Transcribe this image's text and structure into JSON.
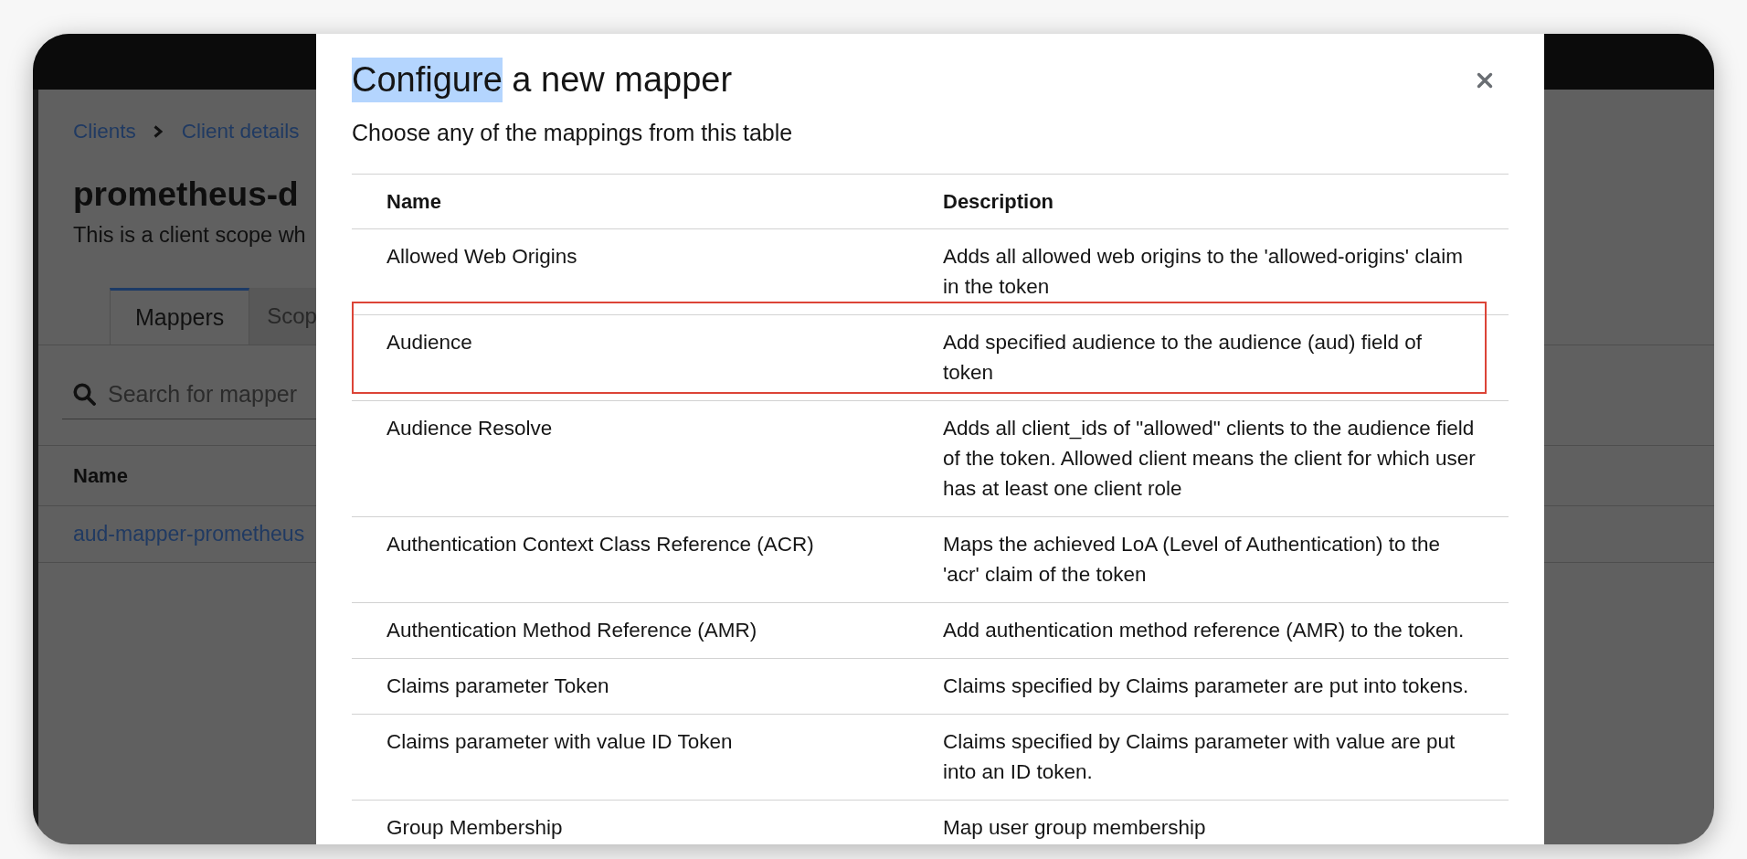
{
  "page": {
    "breadcrumb": [
      "Clients",
      "Client details"
    ],
    "title": "prometheus-d",
    "description": "This is a client scope wh",
    "tabs": [
      {
        "label": "Mappers",
        "selected": true
      },
      {
        "label": "Scop",
        "selected": false
      }
    ],
    "search": {
      "placeholder": "Search for mapper"
    },
    "table": {
      "columns": [
        "Name"
      ],
      "rows": [
        {
          "name": "aud-mapper-prometheus"
        }
      ]
    }
  },
  "modal": {
    "title_parts": [
      {
        "text": "Configure",
        "highlighted": true
      },
      {
        "text": "a new mapper",
        "highlighted": false
      }
    ],
    "subtitle": "Choose any of the mappings from this table",
    "table": {
      "columns": [
        "Name",
        "Description"
      ],
      "rows": [
        {
          "name": "Allowed Web Origins",
          "description": "Adds all allowed web origins to the 'allowed-origins' claim\nin the token",
          "highlighted": false
        },
        {
          "name": "Audience",
          "description": "Add specified audience to the audience (aud) field of\ntoken",
          "highlighted": true
        },
        {
          "name": "Audience Resolve",
          "description": "Adds all client_ids of \"allowed\" clients to the audience field\nof the token. Allowed client means the client for which user\nhas at least one client role",
          "highlighted": false
        },
        {
          "name": "Authentication Context Class Reference (ACR)",
          "description": "Maps the achieved LoA (Level of Authentication) to the\n'acr' claim of the token",
          "highlighted": false
        },
        {
          "name": "Authentication Method Reference (AMR)",
          "description": "Add authentication method reference (AMR) to the token.",
          "highlighted": false
        },
        {
          "name": "Claims parameter Token",
          "description": "Claims specified by Claims parameter are put into tokens.",
          "highlighted": false
        },
        {
          "name": "Claims parameter with value ID Token",
          "description": "Claims specified by Claims parameter with value are put\ninto an ID token.",
          "highlighted": false
        },
        {
          "name": "Group Membership",
          "description": "Map user group membership",
          "highlighted": false
        }
      ]
    }
  }
}
